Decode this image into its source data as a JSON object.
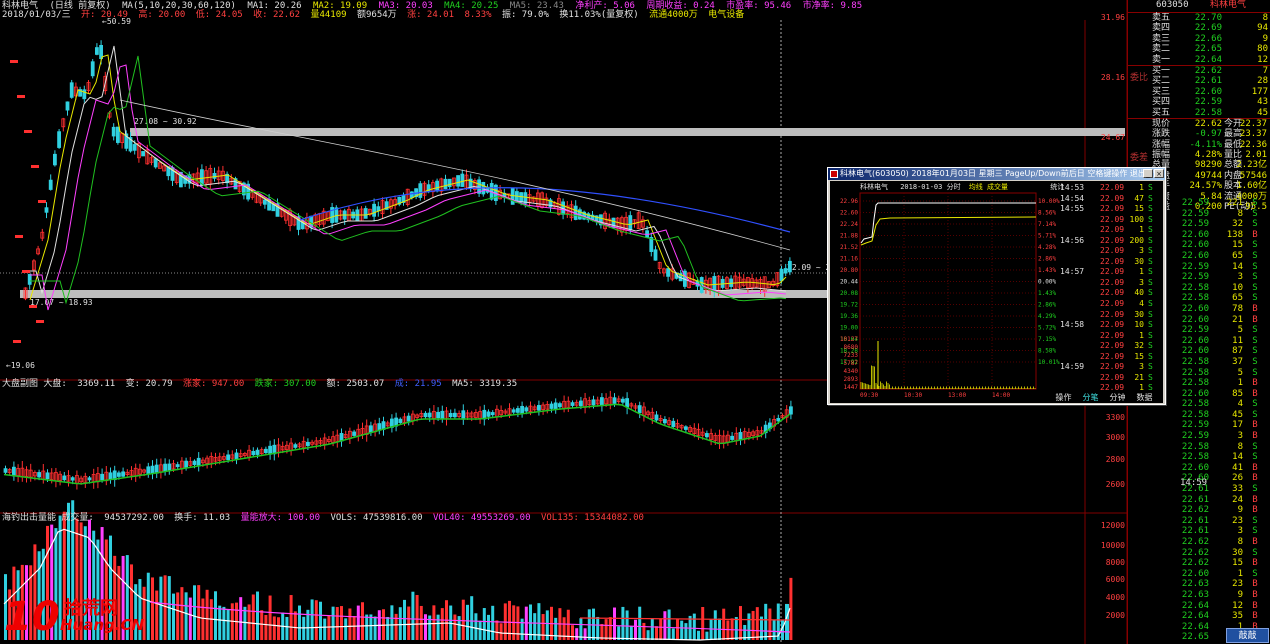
{
  "header": {
    "stock_name": "科林电气",
    "period": "(日线 前复权)",
    "ma_label": "MA(5,10,20,30,60,120)",
    "ma1": "MA1: 20.26",
    "ma2": "MA2: 19.09",
    "ma3": "MA3: 20.03",
    "ma4": "MA4: 20.25",
    "ma5": "MA5: 23.43",
    "extra1": "净利产: 5.06",
    "extra2": "周期收益: 0.24",
    "extra3": "市盈率: 95.46",
    "extra4": "市净率: 9.85",
    "date_info": "2018/01/03/三",
    "open": "开: 20.49",
    "high": "高: 20.00",
    "low": "低: 24.05",
    "close": "收: 22.62",
    "vol": "量44109",
    "amount": "额9654万",
    "change": "涨: 24.01",
    "pct": "8.33%",
    "amp": "振: 79.0%",
    "turnover": "换11.03%(量复权)",
    "float": "流通4000万",
    "sector": "电气设备"
  },
  "index_bar": {
    "name": "大盘副图 大盘:",
    "close": "3369.11",
    "chg": "变: 20.79",
    "up": "涨家: 947.00",
    "down": "跌家: 307.00",
    "flat": "额: 2503.07",
    "v1": "成: 21.95",
    "ma5": "MA5: 3319.35"
  },
  "vol_bar": {
    "name": "海钓出击量能 成交量:",
    "vol": "94537292.00",
    "chg": "换手: 11.03",
    "flag": "量能放大: 100.00",
    "vols": "VOLS: 47539816.00",
    "vol40": "VOL40: 49553269.00",
    "vol135": "VOL135: 15344082.00"
  },
  "chart_labels": {
    "hi_label": "50.59",
    "lo_label": "19.06",
    "band_top": "27.08 ~ 30.92",
    "band_bot": "17.07 ~ 18.93",
    "curr_label": "22.09 ~ 22.36",
    "y_main": [
      "31.96",
      "28.16",
      "24.67",
      "21.06",
      "18.48"
    ],
    "y_idx": [
      "3300",
      "3000",
      "2800",
      "2600"
    ],
    "y_vol": [
      "12000",
      "10000",
      "8000",
      "6000",
      "4000",
      "2000"
    ]
  },
  "right_panel": {
    "code": "603050",
    "name": "科林电气",
    "side_sell": "委比",
    "side_buy": "委差",
    "sells": [
      {
        "label": "卖五",
        "price": "22.70",
        "vol": "8"
      },
      {
        "label": "卖四",
        "price": "22.69",
        "vol": "94"
      },
      {
        "label": "卖三",
        "price": "22.66",
        "vol": "9"
      },
      {
        "label": "卖二",
        "price": "22.65",
        "vol": "80"
      },
      {
        "label": "卖一",
        "price": "22.64",
        "vol": "12"
      }
    ],
    "buys": [
      {
        "label": "买一",
        "price": "22.62",
        "vol": "7"
      },
      {
        "label": "买二",
        "price": "22.61",
        "vol": "28"
      },
      {
        "label": "买三",
        "price": "22.60",
        "vol": "177"
      },
      {
        "label": "买四",
        "price": "22.59",
        "vol": "43"
      },
      {
        "label": "买五",
        "price": "22.58",
        "vol": "45"
      }
    ],
    "stats": [
      {
        "a": "现价",
        "b": "22.62",
        "c": "今开",
        "d": "22.37"
      },
      {
        "a": "涨跌",
        "b": "-0.97",
        "c": "最高",
        "d": "23.37"
      },
      {
        "a": "涨幅",
        "b": "-4.11%",
        "c": "最低",
        "d": "22.36"
      },
      {
        "a": "振幅",
        "b": "4.28%",
        "c": "量比",
        "d": "2.01"
      },
      {
        "a": "总量",
        "b": "98290",
        "c": "总额",
        "d": "2.23亿"
      },
      {
        "a": "外盘",
        "b": "49744",
        "c": "内盘",
        "d": "57546"
      },
      {
        "a": "换手",
        "b": "24.57%",
        "c": "股本",
        "d": "1.60亿"
      },
      {
        "a": "净资",
        "b": "5.84",
        "c": "流通",
        "d": "4000万"
      },
      {
        "a": "收益",
        "b": "0.200",
        "c": "PE(动)",
        "d": "95.5"
      }
    ],
    "time": "14:59",
    "badge": "敲敲",
    "ticks": [
      {
        "p": "22.59",
        "v": "221",
        "f": "S"
      },
      {
        "p": "22.59",
        "v": "8",
        "f": "S"
      },
      {
        "p": "22.59",
        "v": "32",
        "f": "S"
      },
      {
        "p": "22.60",
        "v": "138",
        "f": "B"
      },
      {
        "p": "22.60",
        "v": "15",
        "f": "S"
      },
      {
        "p": "22.60",
        "v": "65",
        "f": "S"
      },
      {
        "p": "22.59",
        "v": "14",
        "f": "S"
      },
      {
        "p": "22.59",
        "v": "3",
        "f": "S"
      },
      {
        "p": "22.58",
        "v": "10",
        "f": "S"
      },
      {
        "p": "22.58",
        "v": "65",
        "f": "S"
      },
      {
        "p": "22.60",
        "v": "78",
        "f": "B"
      },
      {
        "p": "22.60",
        "v": "21",
        "f": "B"
      },
      {
        "p": "22.59",
        "v": "5",
        "f": "S"
      },
      {
        "p": "22.60",
        "v": "11",
        "f": "S"
      },
      {
        "p": "22.60",
        "v": "87",
        "f": "S"
      },
      {
        "p": "22.58",
        "v": "37",
        "f": "S"
      },
      {
        "p": "22.58",
        "v": "5",
        "f": "S"
      },
      {
        "p": "22.58",
        "v": "1",
        "f": "B"
      },
      {
        "p": "22.60",
        "v": "85",
        "f": "B"
      },
      {
        "p": "22.58",
        "v": "4",
        "f": "S"
      },
      {
        "p": "22.58",
        "v": "45",
        "f": "S"
      },
      {
        "p": "22.59",
        "v": "17",
        "f": "B"
      },
      {
        "p": "22.59",
        "v": "3",
        "f": "B"
      },
      {
        "p": "22.58",
        "v": "8",
        "f": "S"
      },
      {
        "p": "22.58",
        "v": "14",
        "f": "S"
      },
      {
        "p": "22.60",
        "v": "41",
        "f": "B"
      },
      {
        "p": "22.60",
        "v": "26",
        "f": "B"
      },
      {
        "p": "22.61",
        "v": "33",
        "f": "S"
      },
      {
        "p": "22.61",
        "v": "24",
        "f": "B"
      },
      {
        "p": "22.62",
        "v": "9",
        "f": "B"
      },
      {
        "p": "22.61",
        "v": "23",
        "f": "S"
      },
      {
        "p": "22.61",
        "v": "3",
        "f": "S"
      },
      {
        "p": "22.62",
        "v": "8",
        "f": "B"
      },
      {
        "p": "22.62",
        "v": "30",
        "f": "S"
      },
      {
        "p": "22.62",
        "v": "15",
        "f": "B"
      },
      {
        "p": "22.60",
        "v": "1",
        "f": "S"
      },
      {
        "p": "22.63",
        "v": "23",
        "f": "B"
      },
      {
        "p": "22.63",
        "v": "9",
        "f": "B"
      },
      {
        "p": "22.64",
        "v": "12",
        "f": "B"
      },
      {
        "p": "22.64",
        "v": "35",
        "f": "B"
      },
      {
        "p": "22.64",
        "v": "1",
        "f": "B"
      },
      {
        "p": "22.65",
        "v": "15",
        "f": "S"
      }
    ]
  },
  "popup": {
    "title": "科林电气(603050) 2018年01月03日 星期三 PageUp/Down前后日 空格键操作 退出按(R)",
    "head_name": "科林电气",
    "head_date": "2018-01-03 分时",
    "head_avg": "均线",
    "head_vol": "成交量",
    "head_stat": "统计",
    "y_left": [
      "22.96",
      "22.60",
      "22.24",
      "21.88",
      "21.52",
      "21.16",
      "20.80",
      "20.44",
      "20.08",
      "19.72",
      "19.36",
      "19.00",
      "18.64",
      "18.28",
      "17.92"
    ],
    "y_right": [
      "10.00%",
      "8.56%",
      "7.14%",
      "5.71%",
      "4.28%",
      "2.86%",
      "1.43%",
      "0.00%",
      "1.43%",
      "2.86%",
      "4.29%",
      "5.72%",
      "7.15%",
      "8.58%",
      "10.01%"
    ],
    "vol_ticks": [
      "10127",
      "8680",
      "7233",
      "5787",
      "4340",
      "2893",
      "1447"
    ],
    "x_ticks": [
      "09:30",
      "10:30",
      "13:00",
      "14:00"
    ],
    "tabs": [
      "操作",
      "分笔",
      "分钟",
      "数据"
    ],
    "ticks": [
      {
        "tm": "14:53",
        "p": "22.09",
        "v": "1",
        "f": "S"
      },
      {
        "tm": "14:54",
        "p": "22.09",
        "v": "47",
        "f": "S"
      },
      {
        "tm": "14:55",
        "p": "22.09",
        "v": "15",
        "f": "S"
      },
      {
        "tm": "",
        "p": "22.09",
        "v": "100",
        "f": "S"
      },
      {
        "tm": "",
        "p": "22.09",
        "v": "1",
        "f": "S"
      },
      {
        "tm": "14:56",
        "p": "22.09",
        "v": "200",
        "f": "S"
      },
      {
        "tm": "",
        "p": "22.09",
        "v": "3",
        "f": "S"
      },
      {
        "tm": "",
        "p": "22.09",
        "v": "30",
        "f": "S"
      },
      {
        "tm": "14:57",
        "p": "22.09",
        "v": "1",
        "f": "S"
      },
      {
        "tm": "",
        "p": "22.09",
        "v": "3",
        "f": "S"
      },
      {
        "tm": "",
        "p": "22.09",
        "v": "40",
        "f": "S"
      },
      {
        "tm": "",
        "p": "22.09",
        "v": "4",
        "f": "S"
      },
      {
        "tm": "",
        "p": "22.09",
        "v": "30",
        "f": "S"
      },
      {
        "tm": "14:58",
        "p": "22.09",
        "v": "10",
        "f": "S"
      },
      {
        "tm": "",
        "p": "22.09",
        "v": "1",
        "f": "S"
      },
      {
        "tm": "",
        "p": "22.09",
        "v": "32",
        "f": "S"
      },
      {
        "tm": "",
        "p": "22.09",
        "v": "15",
        "f": "S"
      },
      {
        "tm": "14:59",
        "p": "22.09",
        "v": "3",
        "f": "S"
      },
      {
        "tm": "",
        "p": "22.09",
        "v": "21",
        "f": "S"
      },
      {
        "tm": "",
        "p": "22.09",
        "v": "1",
        "f": "S"
      }
    ]
  },
  "logo": {
    "num": "10",
    "cn": "拾荒网",
    "en": "Huang.CN"
  },
  "colors": {
    "up": "#ff3030",
    "down": "#30d0e0",
    "ma_white": "#e0e0e0",
    "ma_yellow": "#e8e800",
    "ma_magenta": "#ff40ff",
    "ma_green": "#20c020",
    "ma_blue": "#3050ff",
    "grid_red": "#800000"
  }
}
